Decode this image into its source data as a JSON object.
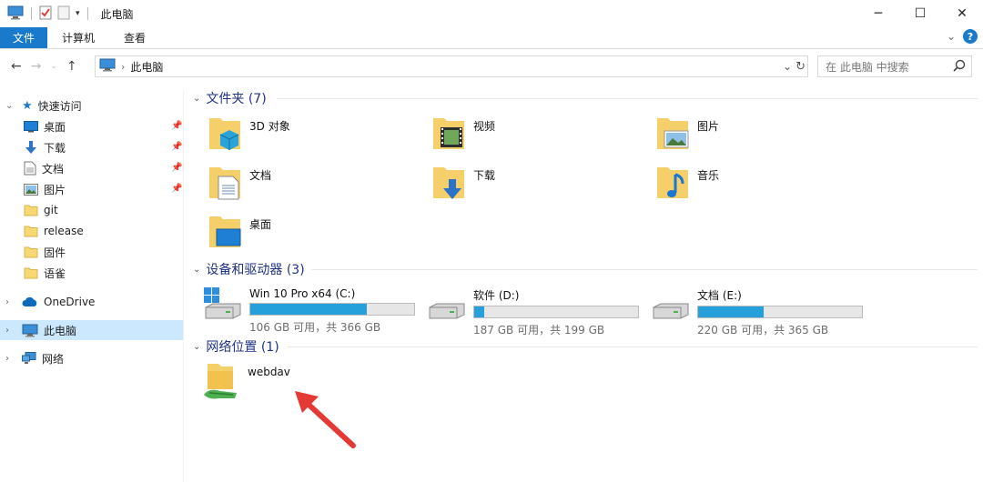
{
  "window": {
    "title": "此电脑",
    "controls": {
      "minimize": "─",
      "maximize": "☐",
      "close": "✕"
    }
  },
  "ribbon": {
    "tabs": [
      {
        "label": "文件",
        "active": true
      },
      {
        "label": "计算机",
        "active": false
      },
      {
        "label": "查看",
        "active": false
      }
    ],
    "expand_icon": "chevron-down-icon",
    "help_label": "?"
  },
  "address": {
    "crumb": "此电脑",
    "search_placeholder": "在 此电脑 中搜索"
  },
  "sidebar": {
    "quick_access_label": "快速访问",
    "items": [
      {
        "label": "桌面",
        "icon": "desktop-icon",
        "pinned": true
      },
      {
        "label": "下载",
        "icon": "download-icon",
        "pinned": true
      },
      {
        "label": "文档",
        "icon": "document-icon",
        "pinned": true
      },
      {
        "label": "图片",
        "icon": "picture-icon",
        "pinned": true
      },
      {
        "label": "git",
        "icon": "folder-icon",
        "pinned": false
      },
      {
        "label": "release",
        "icon": "folder-icon",
        "pinned": false
      },
      {
        "label": "固件",
        "icon": "folder-icon",
        "pinned": false
      },
      {
        "label": "语雀",
        "icon": "folder-icon",
        "pinned": false
      }
    ],
    "onedrive_label": "OneDrive",
    "thispc_label": "此电脑",
    "network_label": "网络"
  },
  "content": {
    "folders_header": "文件夹 (7)",
    "folders": [
      {
        "label": "3D 对象",
        "icon": "3d-objects-folder-icon"
      },
      {
        "label": "视频",
        "icon": "videos-folder-icon"
      },
      {
        "label": "图片",
        "icon": "pictures-folder-icon"
      },
      {
        "label": "文档",
        "icon": "documents-folder-icon"
      },
      {
        "label": "下载",
        "icon": "downloads-folder-icon"
      },
      {
        "label": "音乐",
        "icon": "music-folder-icon"
      },
      {
        "label": "桌面",
        "icon": "desktop-folder-icon"
      }
    ],
    "devices_header": "设备和驱动器 (3)",
    "drives": [
      {
        "label": "Win 10 Pro x64 (C:)",
        "free": "106 GB 可用，共 366 GB",
        "used_fraction": 0.71,
        "icon": "system-drive-icon"
      },
      {
        "label": "软件 (D:)",
        "free": "187 GB 可用，共 199 GB",
        "used_fraction": 0.06,
        "icon": "drive-icon"
      },
      {
        "label": "文档 (E:)",
        "free": "220 GB 可用，共 365 GB",
        "used_fraction": 0.4,
        "icon": "drive-icon"
      }
    ],
    "network_header": "网络位置 (1)",
    "network_locations": [
      {
        "label": "webdav",
        "icon": "network-location-icon"
      }
    ]
  },
  "colors": {
    "accent": "#1979ca",
    "selection": "#cce8ff",
    "drive_bar": "#26a0da",
    "group_header": "#1e3287",
    "annotation_arrow": "#e53935"
  }
}
